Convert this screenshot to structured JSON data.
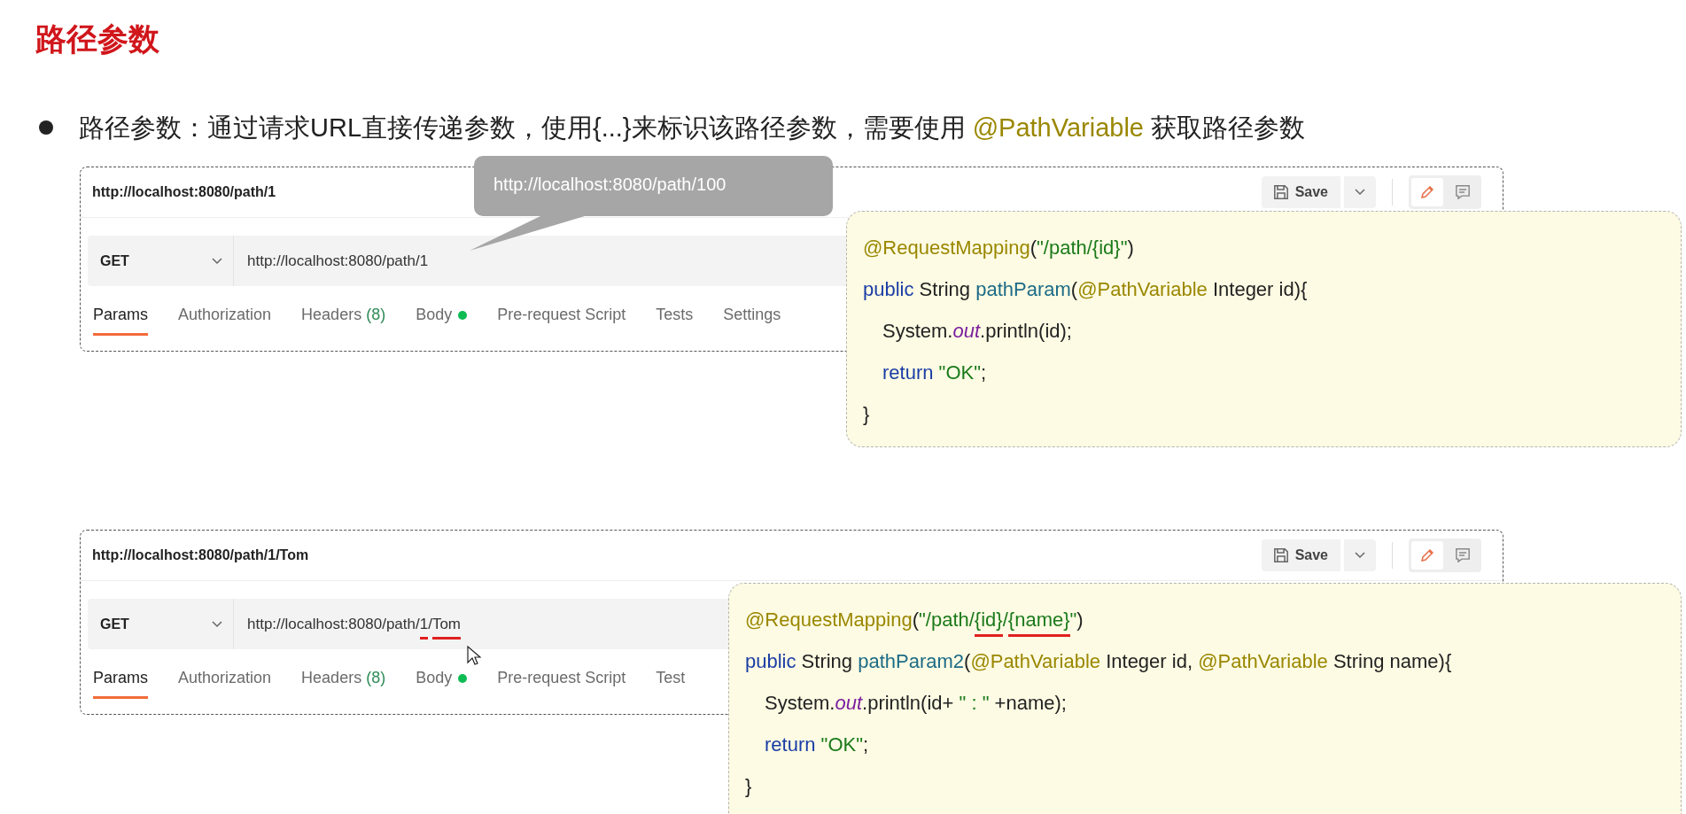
{
  "title": "路径参数",
  "bullet": [
    {
      "kind": "plain",
      "text": "路径参数：通过请求URL直接传递参数，使用{...}来标识该路径参数，需要使用 "
    },
    {
      "kind": "annotation",
      "text": "@PathVariable"
    },
    {
      "kind": "plain",
      "text": " 获取路径参数"
    }
  ],
  "examples": [
    {
      "request_title": "http://localhost:8080/path/1",
      "save_label": "Save",
      "method": "GET",
      "url": [
        {
          "text": "http://localhost:8080/path/1",
          "underlined": false
        }
      ],
      "tabs": [
        {
          "label": "Params",
          "selected": true,
          "dot": false
        },
        {
          "label": "Authorization",
          "selected": false,
          "dot": false
        },
        {
          "label": "Headers",
          "count": "(8)",
          "selected": false,
          "dot": false
        },
        {
          "label": "Body",
          "selected": false,
          "dot": true
        },
        {
          "label": "Pre-request Script",
          "selected": false,
          "dot": false
        },
        {
          "label": "Tests",
          "selected": false,
          "dot": false
        },
        {
          "label": "Settings",
          "selected": false,
          "dot": false
        }
      ],
      "tooltip": "http://localhost:8080/path/100",
      "cursor": false,
      "code": [
        {
          "indent": false,
          "tokens": [
            {
              "kind": "annotation",
              "text": "@RequestMapping"
            },
            {
              "kind": "plain",
              "text": "("
            },
            {
              "kind": "string",
              "text": "\"/path/{id}\""
            },
            {
              "kind": "plain",
              "text": ")"
            }
          ]
        },
        {
          "indent": false,
          "tokens": [
            {
              "kind": "keyword",
              "text": "public"
            },
            {
              "kind": "plain",
              "text": " String "
            },
            {
              "kind": "method",
              "text": "pathParam"
            },
            {
              "kind": "plain",
              "text": "("
            },
            {
              "kind": "annotation",
              "text": "@PathVariable"
            },
            {
              "kind": "plain",
              "text": " Integer id){"
            }
          ]
        },
        {
          "indent": true,
          "tokens": [
            {
              "kind": "plain",
              "text": "System."
            },
            {
              "kind": "field",
              "text": "out"
            },
            {
              "kind": "plain",
              "text": ".println(id);"
            }
          ]
        },
        {
          "indent": true,
          "tokens": [
            {
              "kind": "keyword",
              "text": "return "
            },
            {
              "kind": "string",
              "text": "\"OK\""
            },
            {
              "kind": "plain",
              "text": ";"
            }
          ]
        },
        {
          "indent": false,
          "tokens": [
            {
              "kind": "plain",
              "text": "}"
            }
          ]
        }
      ]
    },
    {
      "request_title": "http://localhost:8080/path/1/Tom",
      "save_label": "Save",
      "method": "GET",
      "url": [
        {
          "text": "http://localhost:8080/path/",
          "underlined": false
        },
        {
          "text": "1",
          "underlined": true
        },
        {
          "text": "/",
          "underlined": false
        },
        {
          "text": "Tom",
          "underlined": true
        }
      ],
      "tabs": [
        {
          "label": "Params",
          "selected": true,
          "dot": false
        },
        {
          "label": "Authorization",
          "selected": false,
          "dot": false
        },
        {
          "label": "Headers",
          "count": "(8)",
          "selected": false,
          "dot": false
        },
        {
          "label": "Body",
          "selected": false,
          "dot": true
        },
        {
          "label": "Pre-request Script",
          "selected": false,
          "dot": false
        },
        {
          "label": "Test",
          "selected": false,
          "dot": false
        }
      ],
      "cursor": true,
      "code": [
        {
          "indent": false,
          "tokens": [
            {
              "kind": "annotation",
              "text": "@RequestMapping"
            },
            {
              "kind": "plain",
              "text": "("
            },
            {
              "kind": "string",
              "text": "\"/path/"
            },
            {
              "kind": "string",
              "text": "{id}",
              "underlined": true
            },
            {
              "kind": "string",
              "text": "/"
            },
            {
              "kind": "string",
              "text": "{name}",
              "underlined": true
            },
            {
              "kind": "string",
              "text": "\""
            },
            {
              "kind": "plain",
              "text": ")"
            }
          ]
        },
        {
          "indent": false,
          "tokens": [
            {
              "kind": "keyword",
              "text": "public"
            },
            {
              "kind": "plain",
              "text": " String "
            },
            {
              "kind": "method",
              "text": "pathParam2"
            },
            {
              "kind": "plain",
              "text": "("
            },
            {
              "kind": "annotation",
              "text": "@PathVariable"
            },
            {
              "kind": "plain",
              "text": " Integer id, "
            },
            {
              "kind": "annotation",
              "text": "@PathVariable"
            },
            {
              "kind": "plain",
              "text": " String name){"
            }
          ]
        },
        {
          "indent": true,
          "tokens": [
            {
              "kind": "plain",
              "text": "System."
            },
            {
              "kind": "field",
              "text": "out"
            },
            {
              "kind": "plain",
              "text": ".println(id+ "
            },
            {
              "kind": "string",
              "text": "\" : \""
            },
            {
              "kind": "plain",
              "text": " +name);"
            }
          ]
        },
        {
          "indent": true,
          "tokens": [
            {
              "kind": "keyword",
              "text": "return "
            },
            {
              "kind": "string",
              "text": "\"OK\""
            },
            {
              "kind": "plain",
              "text": ";"
            }
          ]
        },
        {
          "indent": false,
          "tokens": [
            {
              "kind": "plain",
              "text": "}"
            }
          ]
        }
      ]
    }
  ]
}
